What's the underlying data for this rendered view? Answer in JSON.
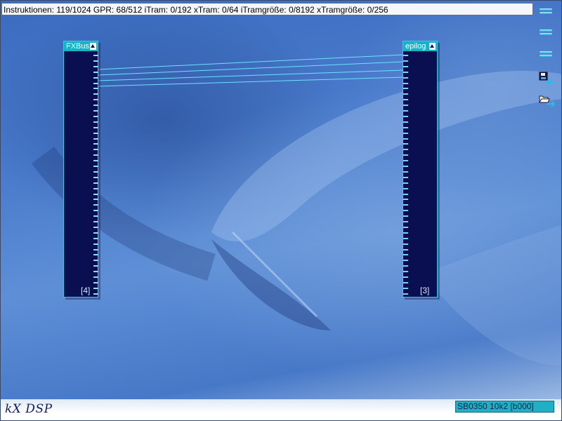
{
  "status": {
    "text": "Instruktionen: 119/1024 GPR: 68/512 iTram: 0/192 xTram: 0/64 iTramgröße: 0/8192 xTramgröße: 0/256"
  },
  "plugins": [
    {
      "id": "fxbus",
      "name": "FXBus",
      "count": "[4]"
    },
    {
      "id": "epilog",
      "name": "epilog",
      "count": "[3]"
    }
  ],
  "side_buttons": [
    {
      "name": "menu-button-1",
      "icon": "menu-bars-icon"
    },
    {
      "name": "menu-button-2",
      "icon": "menu-bars-icon"
    },
    {
      "name": "menu-button-3",
      "icon": "menu-bars-icon"
    },
    {
      "name": "save-settings-button",
      "icon": "floppy-save-icon"
    },
    {
      "name": "load-settings-button",
      "icon": "folder-load-icon"
    }
  ],
  "footer": {
    "brand": "kX DSP",
    "card_id": "SB0350 10k2 [b000]"
  },
  "colors": {
    "plugin_body": "#0a0f52",
    "plugin_title": "#14b3c8",
    "wire": "#6fe0ff",
    "card_badge": "#1fb0c6"
  }
}
